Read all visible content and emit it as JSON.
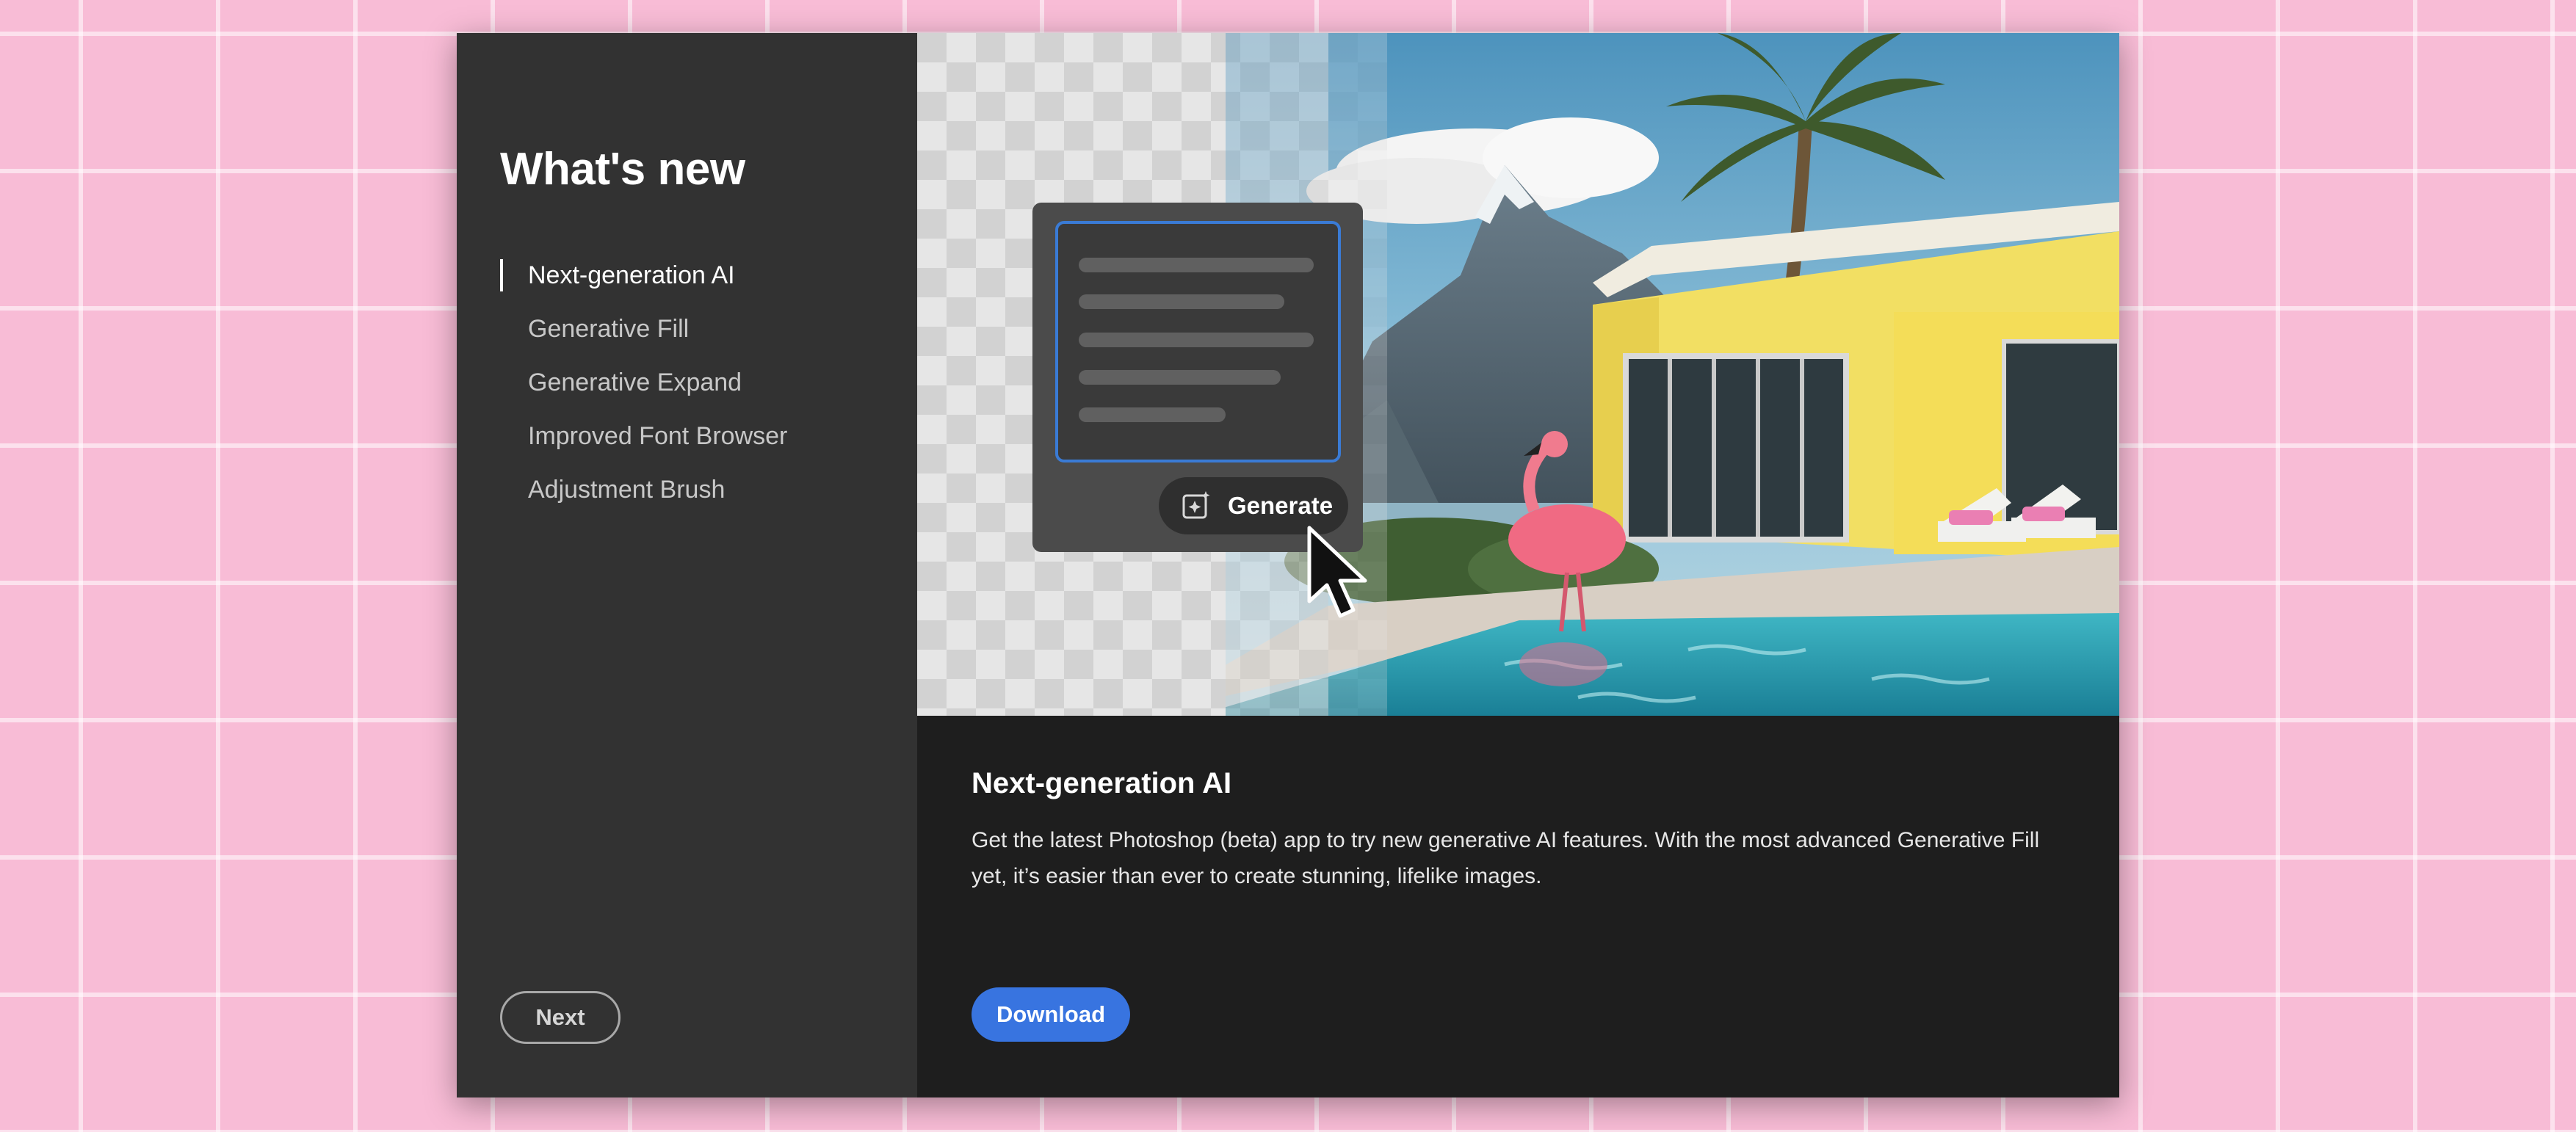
{
  "dialog": {
    "title": "What's new",
    "nav_items": [
      {
        "label": "Next-generation AI",
        "active": true
      },
      {
        "label": "Generative Fill",
        "active": false
      },
      {
        "label": "Generative Expand",
        "active": false
      },
      {
        "label": "Improved Font Browser",
        "active": false
      },
      {
        "label": "Adjustment Brush",
        "active": false
      }
    ],
    "next_button": "Next"
  },
  "hero": {
    "generate_button": "Generate",
    "icons": [
      "generate-sparkle-icon",
      "mouse-pointer-icon"
    ]
  },
  "feature": {
    "heading": "Next-generation AI",
    "description": "Get the latest Photoshop (beta) app to try new generative AI features. With the most advanced Generative Fill yet, it’s easier than ever to create stunning, lifelike images.",
    "download_button": "Download"
  },
  "colors": {
    "background": "#f8bcd6",
    "sidebar": "#323232",
    "panel": "#1e1e1e",
    "accent": "#3874e0"
  }
}
